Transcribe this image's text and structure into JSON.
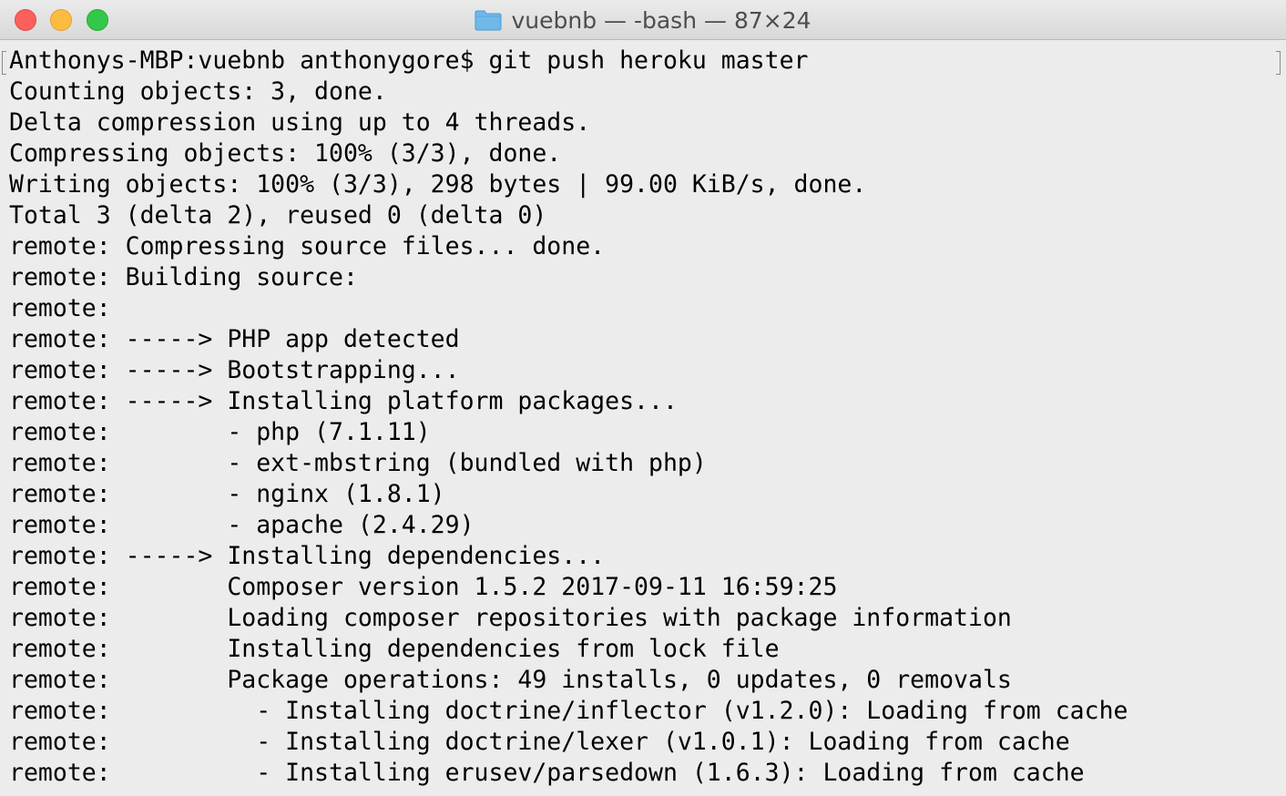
{
  "window": {
    "title": "vuebnb — -bash — 87×24",
    "colors": {
      "close": "#fc605c",
      "minimize": "#fdbc40",
      "zoom": "#34c84a",
      "folder": "#6fb8e8",
      "terminal_bg": "#ececec",
      "text": "#000000"
    }
  },
  "icons": {
    "close": "close-icon",
    "minimize": "minimize-icon",
    "zoom": "zoom-icon",
    "folder": "folder-icon"
  },
  "terminal": {
    "lines": [
      "Anthonys-MBP:vuebnb anthonygore$ git push heroku master",
      "Counting objects: 3, done.",
      "Delta compression using up to 4 threads.",
      "Compressing objects: 100% (3/3), done.",
      "Writing objects: 100% (3/3), 298 bytes | 99.00 KiB/s, done.",
      "Total 3 (delta 2), reused 0 (delta 0)",
      "remote: Compressing source files... done.",
      "remote: Building source:",
      "remote:",
      "remote: -----> PHP app detected",
      "remote: -----> Bootstrapping...",
      "remote: -----> Installing platform packages...",
      "remote:        - php (7.1.11)",
      "remote:        - ext-mbstring (bundled with php)",
      "remote:        - nginx (1.8.1)",
      "remote:        - apache (2.4.29)",
      "remote: -----> Installing dependencies...",
      "remote:        Composer version 1.5.2 2017-09-11 16:59:25",
      "remote:        Loading composer repositories with package information",
      "remote:        Installing dependencies from lock file",
      "remote:        Package operations: 49 installs, 0 updates, 0 removals",
      "remote:          - Installing doctrine/inflector (v1.2.0): Loading from cache",
      "remote:          - Installing doctrine/lexer (v1.0.1): Loading from cache",
      "remote:          - Installing erusev/parsedown (1.6.3): Loading from cache"
    ]
  }
}
